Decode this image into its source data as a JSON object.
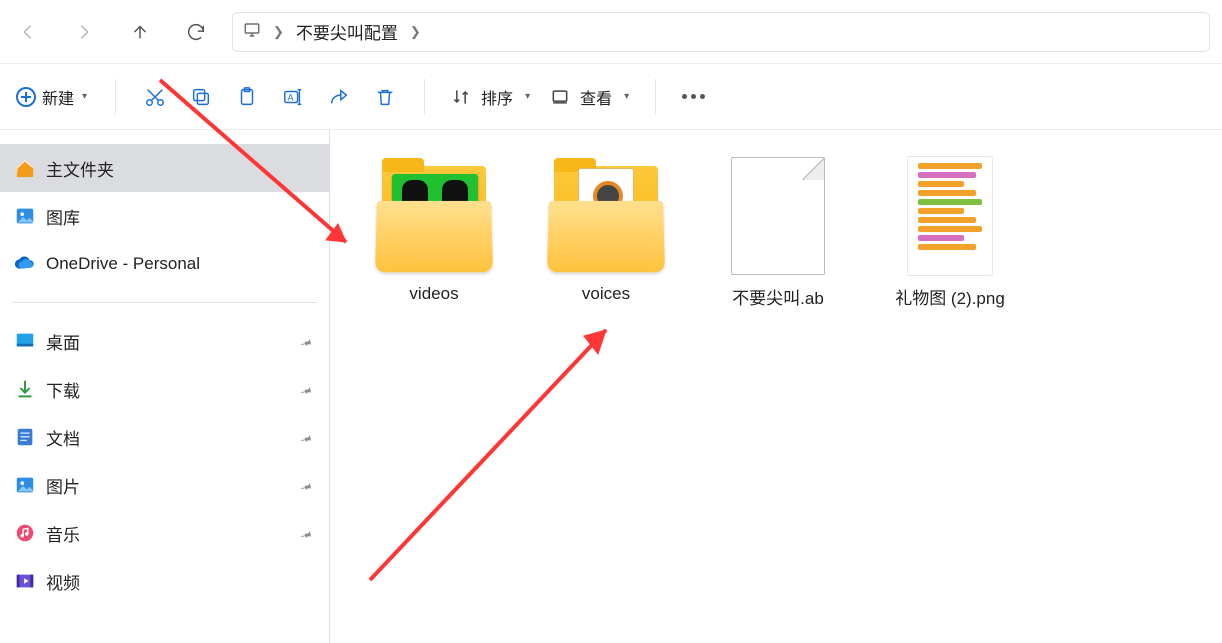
{
  "breadcrumb": {
    "current": "不要尖叫配置"
  },
  "toolbar": {
    "new_label": "新建",
    "sort_label": "排序",
    "view_label": "查看"
  },
  "sidebar": {
    "items": [
      {
        "label": "主文件夹",
        "icon": "home"
      },
      {
        "label": "图库",
        "icon": "gallery"
      },
      {
        "label": "OneDrive - Personal",
        "icon": "onedrive"
      }
    ],
    "quick": [
      {
        "label": "桌面",
        "icon": "desktop"
      },
      {
        "label": "下载",
        "icon": "downloads"
      },
      {
        "label": "文档",
        "icon": "documents"
      },
      {
        "label": "图片",
        "icon": "pictures"
      },
      {
        "label": "音乐",
        "icon": "music"
      },
      {
        "label": "视频",
        "icon": "videos"
      }
    ]
  },
  "files": [
    {
      "label": "videos",
      "kind": "folder-videos"
    },
    {
      "label": "voices",
      "kind": "folder-sounds"
    },
    {
      "label": "不要尖叫.ab",
      "kind": "file"
    },
    {
      "label": "礼物图 (2).png",
      "kind": "png"
    }
  ]
}
